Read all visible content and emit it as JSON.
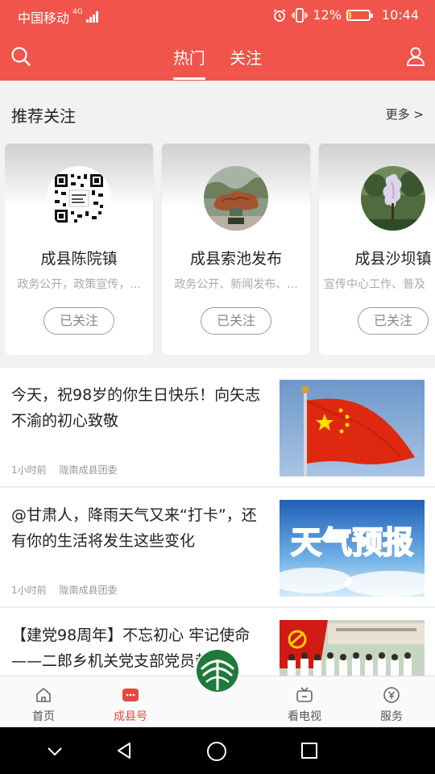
{
  "status_bar": {
    "carrier": "中国移动",
    "network": "4G",
    "battery": "12%",
    "battery_level": 0.12,
    "time": "10:44"
  },
  "header": {
    "tabs": [
      {
        "label": "热门",
        "active": true
      },
      {
        "label": "关注",
        "active": false
      }
    ],
    "search_icon": "search-icon",
    "profile_icon": "user-icon"
  },
  "recommend": {
    "title": "推荐关注",
    "more": "更多 >",
    "cards": [
      {
        "name": "成县陈院镇",
        "desc": "政务公开，政策宣传，...",
        "button": "已关注"
      },
      {
        "name": "成县索池发布",
        "desc": "政务公开、新闻发布、...",
        "button": "已关注"
      },
      {
        "name": "成县沙坝镇",
        "desc": "宣传中心工作、普及",
        "button": "已关注"
      }
    ]
  },
  "news": [
    {
      "title": "今天，祝98岁的你生日快乐！向矢志不渝的初心致敬",
      "time": "1小时前",
      "source": "陇南成县团委",
      "thumb": "flag"
    },
    {
      "title": "@甘肃人，降雨天气又来“打卡”，还有你的生活将发生这些变化",
      "time": "1小时前",
      "source": "陇南成县团委",
      "thumb": "weather",
      "thumb_text": "天气预报"
    },
    {
      "title": "【建党98周年】不忘初心 牢记使命——二郎乡机关党支部党员赴两...",
      "time": "",
      "source": "",
      "thumb": "party"
    }
  ],
  "bottom_nav": [
    {
      "label": "首页",
      "icon": "home-icon",
      "active": false
    },
    {
      "label": "成县号",
      "icon": "chat-icon",
      "active": true
    },
    {
      "label": "看电视",
      "icon": "tv-icon",
      "active": false
    },
    {
      "label": "服务",
      "icon": "service-icon",
      "active": false
    }
  ],
  "colors": {
    "brand": "#f0544a",
    "active_nav": "#e8473c"
  }
}
